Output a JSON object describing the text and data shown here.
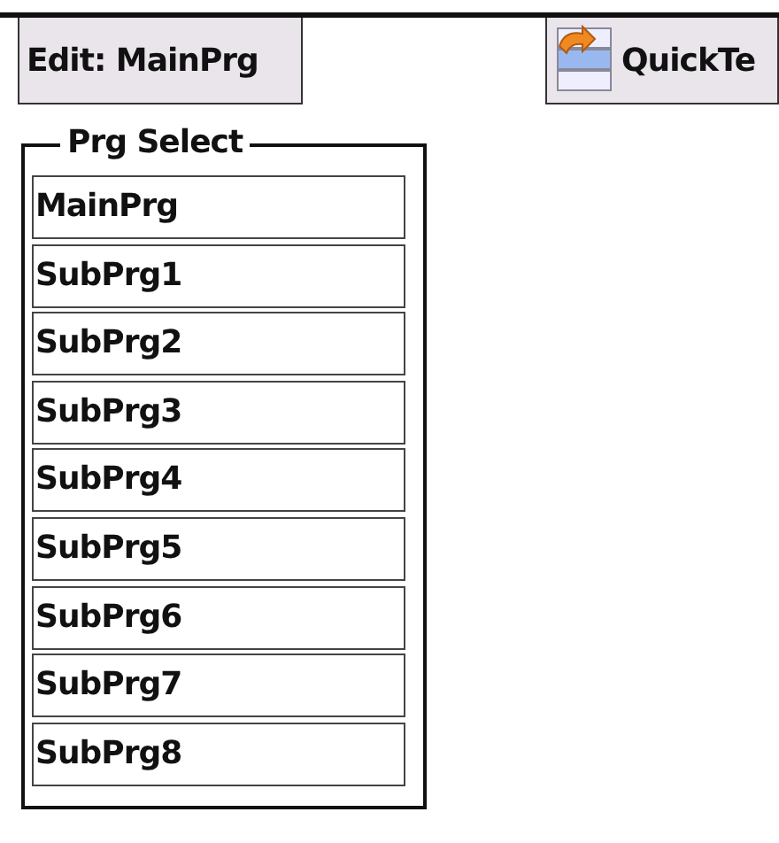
{
  "toolbar": {
    "edit_button": "Edit: MainPrg",
    "quick_button": "QuickTe"
  },
  "prg_select": {
    "title": "Prg Select",
    "items": [
      {
        "label": "MainPrg"
      },
      {
        "label": "SubPrg1"
      },
      {
        "label": "SubPrg2"
      },
      {
        "label": "SubPrg3"
      },
      {
        "label": "SubPrg4"
      },
      {
        "label": "SubPrg5"
      },
      {
        "label": "SubPrg6"
      },
      {
        "label": "SubPrg7"
      },
      {
        "label": "SubPrg8"
      }
    ]
  }
}
